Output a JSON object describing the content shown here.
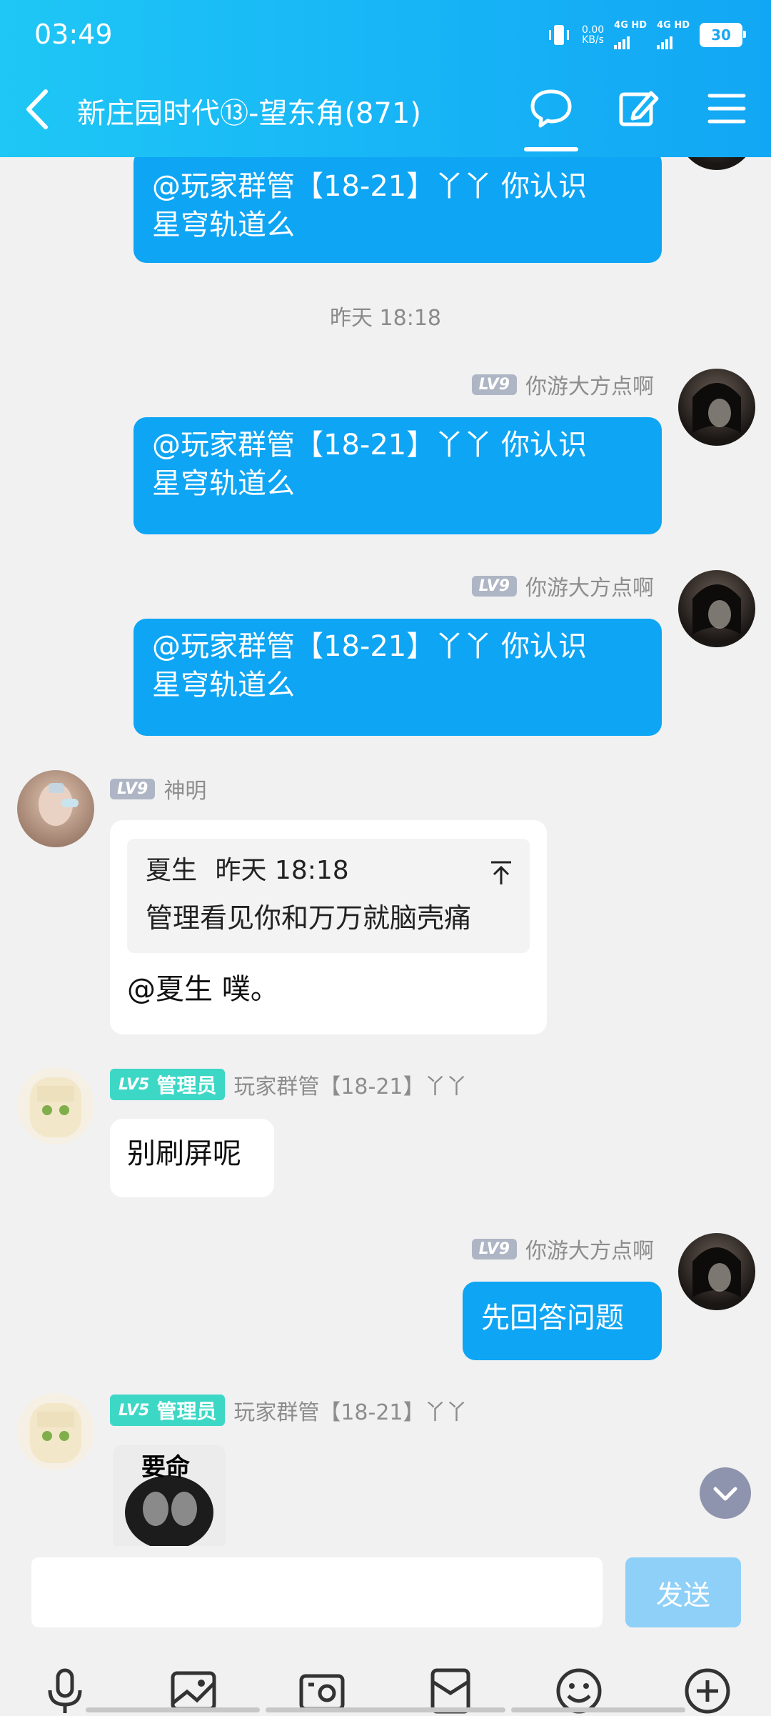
{
  "status_bar": {
    "time": "03:49",
    "net_speed_top": "0.00",
    "net_speed_unit": "KB/s",
    "sim1": "4G HD",
    "sim2": "4G HD",
    "battery": "30"
  },
  "header": {
    "title": "新庄园时代⑬-望东角(871)"
  },
  "messages": {
    "m0": {
      "text_line1": "@玩家群管【18-21】丫丫 你认识",
      "text_line2": "星穹轨道么"
    },
    "time_sep": "昨天 18:18",
    "m1": {
      "level": "LV9",
      "sender": "你游大方点啊",
      "text_line1": "@玩家群管【18-21】丫丫 你认识",
      "text_line2": "星穹轨道么"
    },
    "m2": {
      "level": "LV9",
      "sender": "你游大方点啊",
      "text_line1": "@玩家群管【18-21】丫丫 你认识",
      "text_line2": "星穹轨道么"
    },
    "m3": {
      "level": "LV9",
      "sender": "神明",
      "quote_author": "夏生",
      "quote_time": "昨天 18:18",
      "quote_text": "管理看见你和万万就脑壳痛",
      "text": "@夏生 噗。"
    },
    "m4": {
      "level": "LV5",
      "role": "管理员",
      "sender": "玩家群管【18-21】丫丫",
      "text": "别刷屏呢"
    },
    "m5": {
      "level": "LV9",
      "sender": "你游大方点啊",
      "text": "先回答问题"
    },
    "m6": {
      "level": "LV5",
      "role": "管理员",
      "sender": "玩家群管【18-21】丫丫",
      "sticker_text": "要命"
    }
  },
  "input": {
    "placeholder": "",
    "send_label": "发送"
  },
  "colors": {
    "header_blue": "#17b4f6",
    "bubble_blue": "#0ea5f4",
    "send_disabled": "#8fd0f8",
    "admin_badge": "#3dd7c6"
  },
  "icons": [
    "back-icon",
    "chat-icon",
    "edit-icon",
    "menu-icon",
    "microphone-icon",
    "image-icon",
    "camera-icon",
    "red-packet-icon",
    "emoji-icon",
    "plus-icon",
    "chevron-down-icon"
  ]
}
